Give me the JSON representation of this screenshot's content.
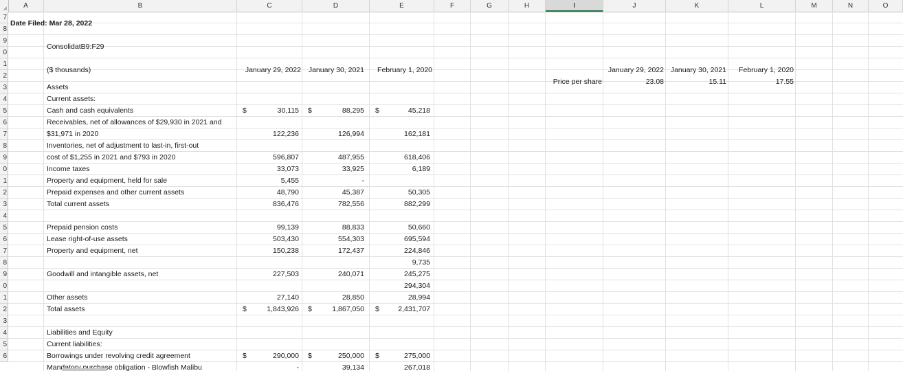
{
  "columns": [
    "A",
    "B",
    "C",
    "D",
    "E",
    "F",
    "G",
    "H",
    "I",
    "J",
    "K",
    "L",
    "M",
    "N",
    "O"
  ],
  "selected_column": "I",
  "rows": [
    "7",
    "8",
    "9",
    "0",
    "1",
    "2",
    "3",
    "4",
    "5",
    "6",
    "7",
    "8",
    "9",
    "0",
    "1",
    "2",
    "3",
    "4",
    "5",
    "6",
    "7",
    "8",
    "9",
    "0",
    "1",
    "2",
    "3",
    "4",
    "5",
    "6"
  ],
  "date_filed": "Date Filed: Mar 28, 2022",
  "range_ref": "ConsolidatB9:F29",
  "headers": {
    "units": "($ thousands)",
    "c": "January 29, 2022",
    "d": "January 30, 2021",
    "e": "February 1, 2020"
  },
  "price": {
    "label": "Price per share",
    "headers": [
      "January 29, 2022",
      "January 30, 2021",
      "February 1, 2020"
    ],
    "values": [
      "23.08",
      "15.11",
      "17.55"
    ]
  },
  "table": [
    {
      "label": "Assets",
      "c": "",
      "d": "",
      "e": ""
    },
    {
      "label": "Current assets:",
      "c": "",
      "d": "",
      "e": ""
    },
    {
      "label": "Cash and cash equivalents",
      "cs": "$",
      "c": "30,115",
      "ds": "$",
      "d": "88,295",
      "es": "$",
      "e": "45,218"
    },
    {
      "label": "Receivables, net of allowances of $29,930 in 2021 and",
      "c": "",
      "d": "",
      "e": ""
    },
    {
      "label": "$31,971 in 2020",
      "c": "122,236",
      "d": "126,994",
      "e": "162,181"
    },
    {
      "label": "Inventories, net of adjustment to last-in, first-out",
      "c": "",
      "d": "",
      "e": ""
    },
    {
      "label": "cost of $1,255 in 2021 and $793 in 2020",
      "c": "596,807",
      "d": "487,955",
      "e": "618,406"
    },
    {
      "label": "Income taxes",
      "c": "33,073",
      "d": "33,925",
      "e": "6,189"
    },
    {
      "label": "Property and equipment, held for sale",
      "c": "5,455",
      "d": "-",
      "e": ""
    },
    {
      "label": "Prepaid expenses and other current assets",
      "c": "48,790",
      "d": "45,387",
      "e": "50,305"
    },
    {
      "label": "Total current assets",
      "c": "836,476",
      "d": "782,556",
      "e": "882,299"
    },
    {
      "label": "",
      "c": "",
      "d": "",
      "e": ""
    },
    {
      "label": "Prepaid pension costs",
      "c": "99,139",
      "d": "88,833",
      "e": "50,660"
    },
    {
      "label": "Lease right-of-use assets",
      "c": "503,430",
      "d": "554,303",
      "e": "695,594"
    },
    {
      "label": "Property and equipment, net",
      "c": "150,238",
      "d": "172,437",
      "e": "224,846"
    },
    {
      "label": "",
      "c": "",
      "d": "",
      "e": "9,735"
    },
    {
      "label": "Goodwill and intangible assets, net",
      "c": "227,503",
      "d": "240,071",
      "e": "245,275"
    },
    {
      "label": "",
      "c": "",
      "d": "",
      "e": "294,304"
    },
    {
      "label": "Other assets",
      "c": "27,140",
      "d": "28,850",
      "e": "28,994"
    },
    {
      "label": "Total assets",
      "cs": "$",
      "c": "1,843,926",
      "ds": "$",
      "d": "1,867,050",
      "es": "$",
      "e": "2,431,707"
    },
    {
      "label": "",
      "c": "",
      "d": "",
      "e": ""
    },
    {
      "label": "Liabilities and Equity",
      "c": "",
      "d": "",
      "e": ""
    },
    {
      "label": "Current liabilities:",
      "c": "",
      "d": "",
      "e": ""
    },
    {
      "label": "Borrowings under revolving credit agreement",
      "cs": "$",
      "c": "290,000",
      "ds": "$",
      "d": "250,000",
      "es": "$",
      "e": "275,000"
    },
    {
      "label": "Mandatory purchase obligation - Blowfish Malibu",
      "c": "-",
      "d": "39,134",
      "e": "267,018"
    }
  ]
}
